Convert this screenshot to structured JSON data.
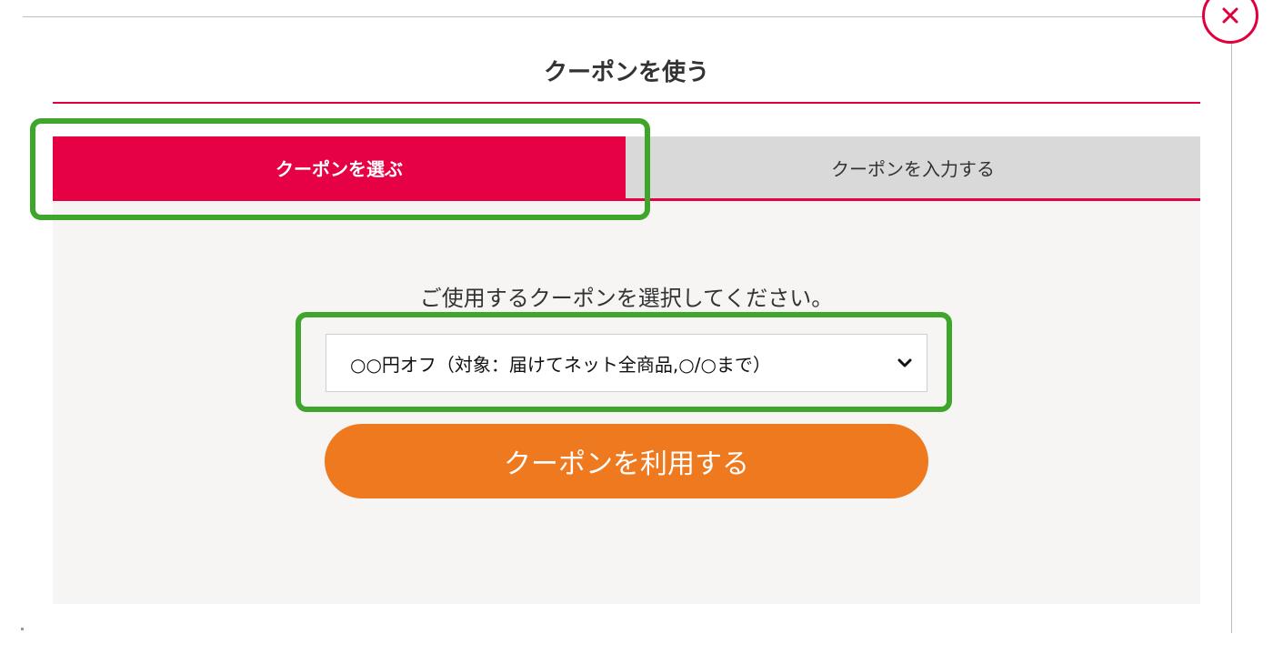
{
  "modal": {
    "title": "クーポンを使う",
    "close_icon": "close-icon"
  },
  "tabs": [
    {
      "label": "クーポンを選ぶ",
      "active": true
    },
    {
      "label": "クーポンを入力する",
      "active": false
    }
  ],
  "panel": {
    "instruction": "ご使用するクーポンを選択してください。",
    "select": {
      "selected": "○○円オフ（対象：届けてネット全商品,○/○まで）",
      "icon": "chevron-down-icon"
    },
    "submit_label": "クーポンを利用する"
  },
  "colors": {
    "accent": "#e60044",
    "button": "#ee791e",
    "tab_inactive": "#d9d9d9",
    "panel_bg": "#f6f5f4",
    "highlight": "#3fa62c"
  }
}
